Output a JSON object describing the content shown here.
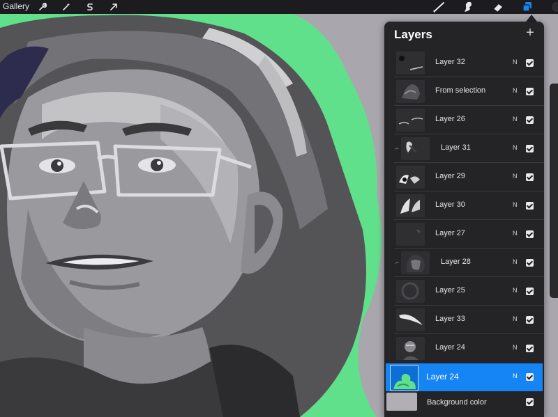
{
  "toolbar": {
    "gallery_label": "Gallery",
    "left_tools": [
      "wrench-icon",
      "magic-wand-icon",
      "selection-icon",
      "transform-arrow-icon"
    ],
    "right_tools": [
      "brush-icon",
      "smudge-icon",
      "eraser-icon",
      "layers-icon",
      "color-swatch"
    ],
    "accent": "#1584f5"
  },
  "layers_panel": {
    "title": "Layers",
    "add_button": "+",
    "layers": [
      {
        "name": "Layer 32",
        "blend": "N",
        "visible": true
      },
      {
        "name": "From selection",
        "blend": "N",
        "visible": true
      },
      {
        "name": "Layer 26",
        "blend": "N",
        "visible": true
      },
      {
        "name": "Layer 31",
        "blend": "N",
        "visible": true
      },
      {
        "name": "Layer 29",
        "blend": "N",
        "visible": true
      },
      {
        "name": "Layer 30",
        "blend": "N",
        "visible": true
      },
      {
        "name": "Layer 27",
        "blend": "N",
        "visible": true
      },
      {
        "name": "Layer 28",
        "blend": "N",
        "visible": true
      },
      {
        "name": "Layer 25",
        "blend": "N",
        "visible": true
      },
      {
        "name": "Layer 33",
        "blend": "N",
        "visible": true
      },
      {
        "name": "Layer 24",
        "blend": "N",
        "visible": true
      }
    ],
    "active_layer": {
      "name": "Layer 24",
      "blend": "N",
      "visible": true
    },
    "background_layer": {
      "name": "Background color",
      "visible": true,
      "color": "#b1afb5"
    }
  },
  "canvas": {
    "background": "#a9a7ad",
    "halo_color": "#61e08c"
  }
}
